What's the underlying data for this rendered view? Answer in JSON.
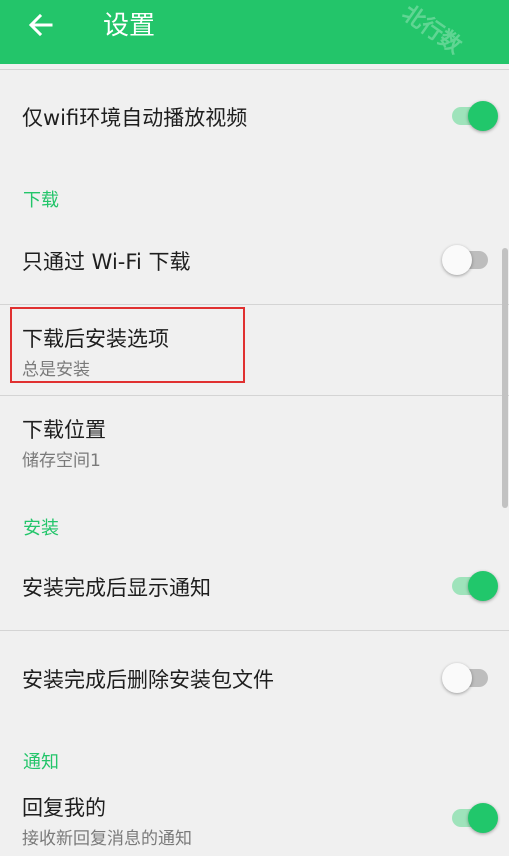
{
  "appbar": {
    "title": "设置",
    "back_icon": "arrow-left-icon",
    "bg_color": "#23c56a"
  },
  "settings": {
    "wifi_video": {
      "label": "仅wifi环境自动播放视频",
      "enabled": true
    },
    "download_section": {
      "title": "下载"
    },
    "wifi_only_download": {
      "label": "只通过 Wi-Fi 下载",
      "enabled": false
    },
    "post_download_install": {
      "label": "下载后安装选项",
      "value": "总是安装"
    },
    "download_location": {
      "label": "下载位置",
      "value": "储存空间1"
    },
    "install_section": {
      "title": "安装"
    },
    "install_notify": {
      "label": "安装完成后显示通知",
      "enabled": true
    },
    "delete_after_install": {
      "label": "安装完成后删除安装包文件",
      "enabled": false
    },
    "notify_section": {
      "title": "通知"
    },
    "reply_me": {
      "label": "回复我的",
      "desc": "接收新回复消息的通知",
      "enabled": true
    }
  },
  "colors": {
    "accent": "#23c56a",
    "highlight_border": "#e03030"
  }
}
